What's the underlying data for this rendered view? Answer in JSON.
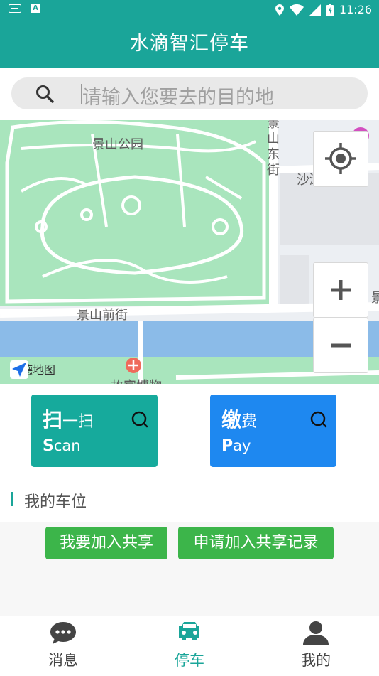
{
  "status_bar": {
    "time": "11:26"
  },
  "app_bar": {
    "title": "水滴智汇停车"
  },
  "search": {
    "placeholder": "请输入您要去的目的地"
  },
  "map": {
    "labels": {
      "park": "景山公园",
      "east_street": "景山东街",
      "shatan": "沙滩后街",
      "front_street": "景山前街",
      "gaode": "高德地图",
      "museum": "故宫博物",
      "edge": "景"
    }
  },
  "actions": {
    "scan": {
      "big": "扫",
      "small": "一扫",
      "en_first": "S",
      "en_rest": "can",
      "color": "#16aa9c"
    },
    "pay": {
      "big": "缴",
      "small": "费",
      "en_first": "P",
      "en_rest": "ay",
      "color": "#1e88f0"
    }
  },
  "section": {
    "title": "我的车位"
  },
  "share_buttons": [
    {
      "label": "我要加入共享"
    },
    {
      "label": "申请加入共享记录"
    }
  ],
  "tabs": [
    {
      "label": "消息",
      "icon": "chat-icon"
    },
    {
      "label": "停车",
      "icon": "car-icon",
      "active": true
    },
    {
      "label": "我的",
      "icon": "person-icon"
    }
  ],
  "colors": {
    "primary": "#1aa599",
    "green_button": "#3cb54a"
  }
}
